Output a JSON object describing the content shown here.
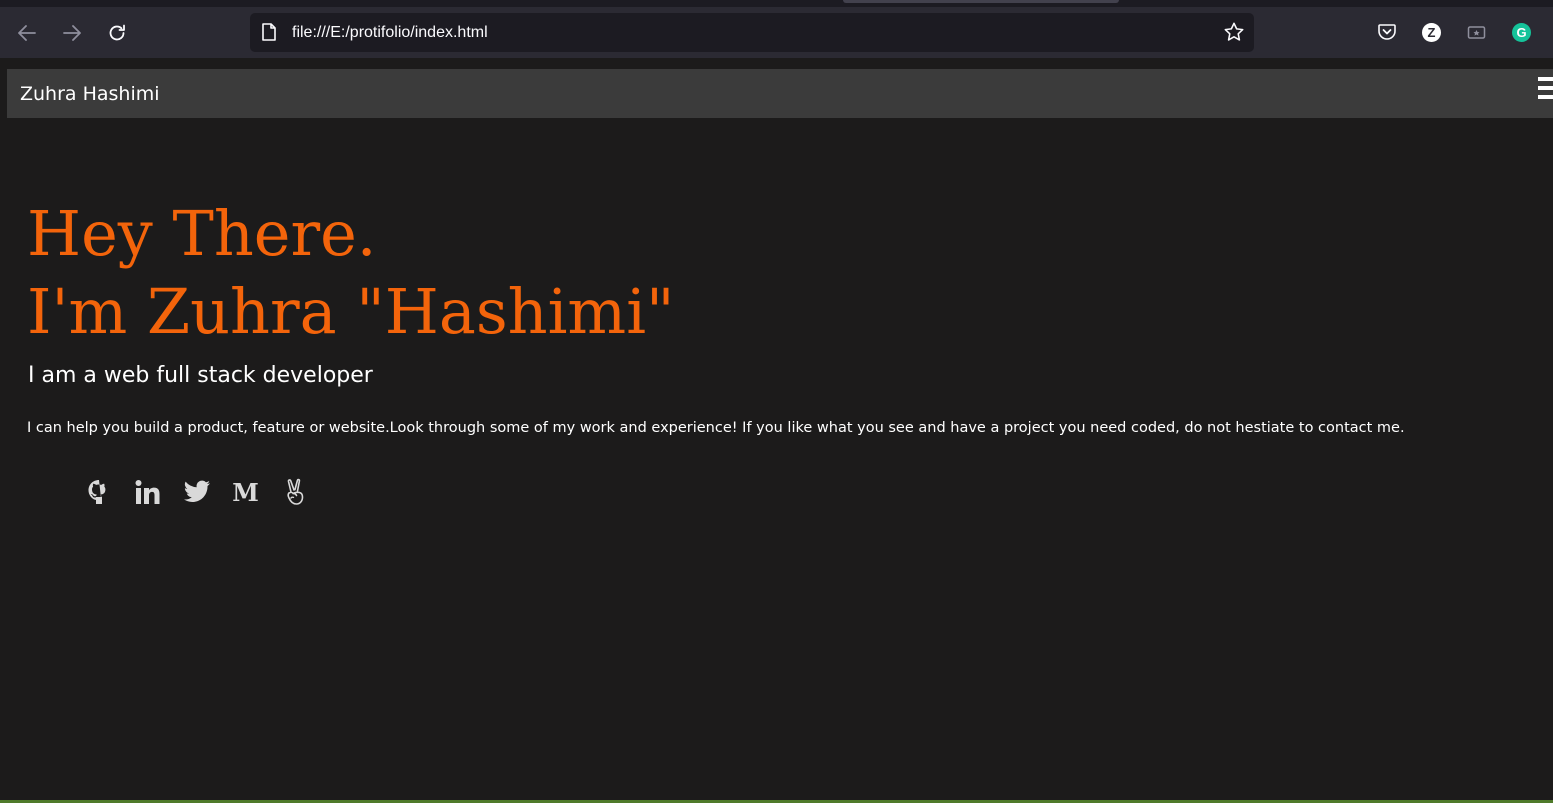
{
  "browser": {
    "url": "file:///E:/protifolio/index.html",
    "icons": {
      "back": "arrow-left-icon",
      "forward": "arrow-right-icon",
      "reload": "reload-icon",
      "page": "page-icon",
      "bookmark": "star-icon",
      "pocket": "pocket-icon",
      "ext_z_letter": "Z",
      "ext_g_letter": "G"
    },
    "colors": {
      "toolbar": "#2b2a33",
      "urlbar": "#1c1b22"
    }
  },
  "site": {
    "brand": "Zuhra Hashimi",
    "hero": {
      "line1": "Hey There.",
      "line2": "I'm Zuhra \"Hashimi\"",
      "subtitle": "I am a web full stack developer",
      "description": "I can help you build a product, feature or website.Look through some of my work and experience! If you like what you see and have a project you need coded, do not hestiate to contact me."
    },
    "social": [
      {
        "name": "github",
        "icon": "github-icon"
      },
      {
        "name": "linkedin",
        "icon": "linkedin-icon"
      },
      {
        "name": "twitter",
        "icon": "twitter-icon"
      },
      {
        "name": "medium",
        "icon": "medium-icon",
        "glyph": "M"
      },
      {
        "name": "angellist",
        "icon": "angellist-icon"
      }
    ],
    "colors": {
      "accent": "#f3640b",
      "background": "#1c1b1b",
      "navbar": "#3b3b3b",
      "text": "#ffffff",
      "icon": "#d9d9d9"
    }
  }
}
